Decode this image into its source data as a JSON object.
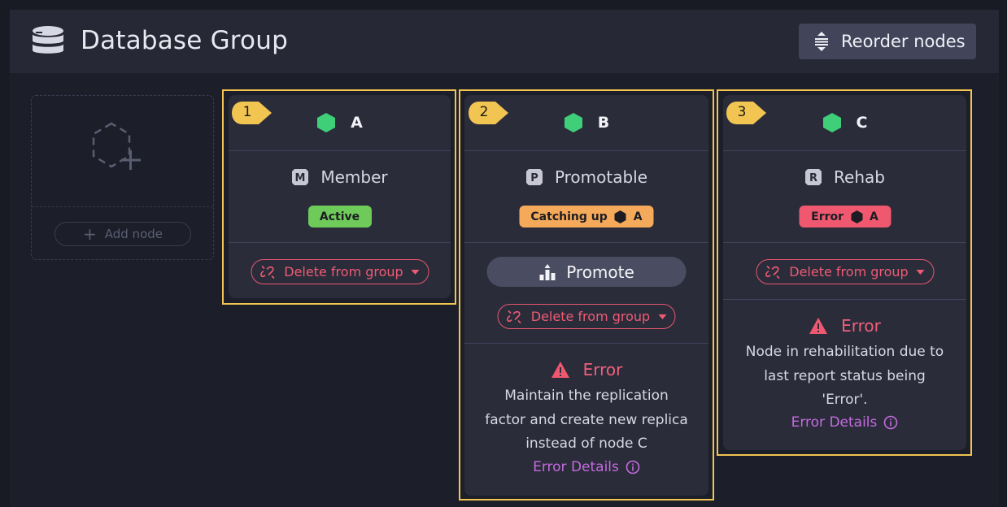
{
  "header": {
    "title": "Database Group",
    "icon": "database-icon",
    "reorder_label": "Reorder nodes",
    "reorder_icon": "reorder-icon"
  },
  "add_node": {
    "label": "Add node",
    "icon": "add-node-icon"
  },
  "colors": {
    "frame": "#f2c451",
    "node_ok": "#3fcf78",
    "active": "#6ecb5a",
    "catching_up": "#f5a95a",
    "error": "#f0586f",
    "error_details": "#c56be0"
  },
  "nodes": [
    {
      "order": "1",
      "tag": "A",
      "type_icon": "member-icon",
      "type_label": "Member",
      "status_label": "Active",
      "status_node": "",
      "delete_label": "Delete from group"
    },
    {
      "order": "2",
      "tag": "B",
      "type_icon": "promotable-icon",
      "type_label": "Promotable",
      "status_label": "Catching up",
      "status_node": "A",
      "promote_label": "Promote",
      "delete_label": "Delete from group",
      "error_title": "Error",
      "error_lines": [
        "Maintain the replication",
        "factor and create new replica",
        "instead of node C"
      ],
      "error_details": "Error Details"
    },
    {
      "order": "3",
      "tag": "C",
      "type_icon": "rehab-icon",
      "type_label": "Rehab",
      "status_label": "Error",
      "status_node": "A",
      "delete_label": "Delete from group",
      "error_title": "Error",
      "error_lines": [
        "Node in rehabilitation due to",
        "last report status being",
        "'Error'."
      ],
      "error_details": "Error Details"
    }
  ]
}
